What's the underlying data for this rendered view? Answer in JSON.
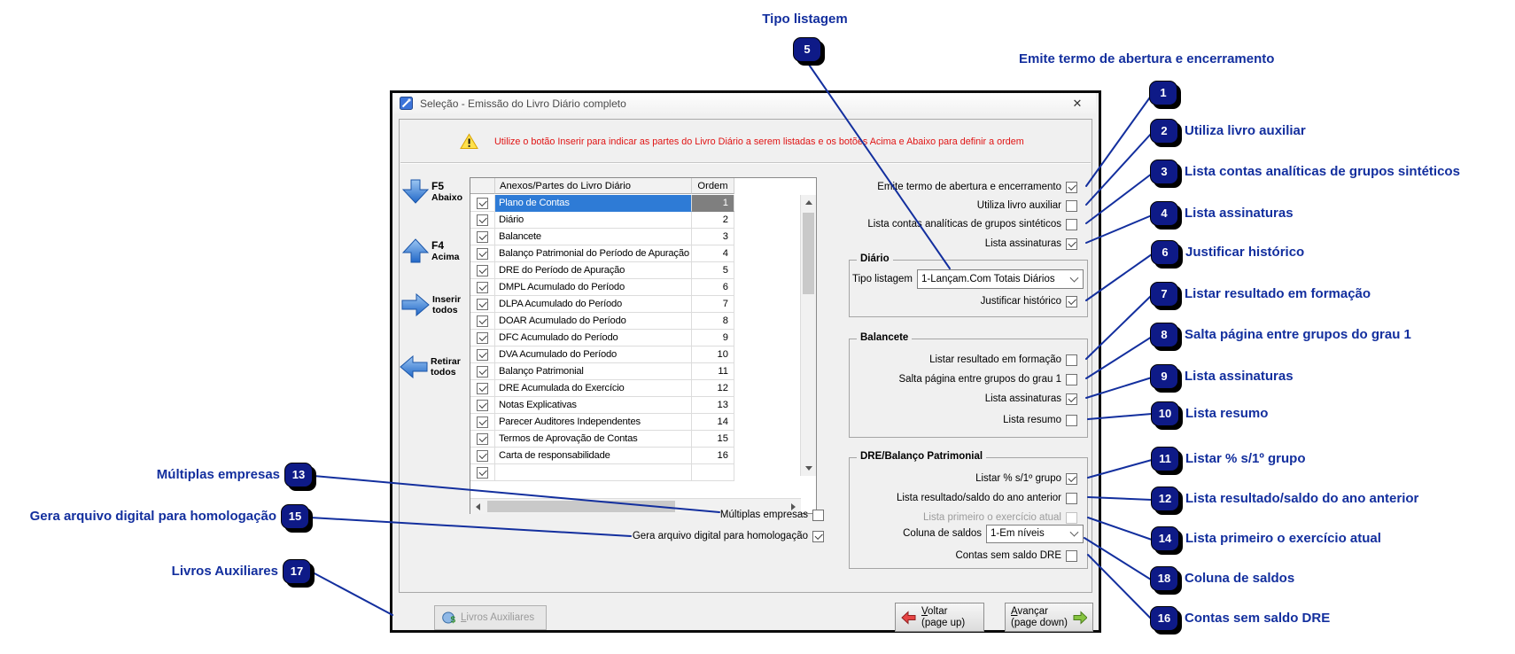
{
  "colors": {
    "annotation_blue": "#132f9e",
    "badge_navy": "#0e1a87",
    "warning_red": "#e01414",
    "selection_blue": "#2e7bd6",
    "selection_gray": "#7f7f7f",
    "arrow_blue": "#2268c8",
    "back_red": "#e64444",
    "forward_green": "#86c440"
  },
  "annotations": {
    "top": {
      "n": "5",
      "label": "Tipo listagem"
    },
    "right": [
      {
        "n": "1",
        "label": "Emite termo de abertura e encerramento"
      },
      {
        "n": "2",
        "label": "Utiliza livro auxiliar"
      },
      {
        "n": "3",
        "label": "Lista contas analíticas de grupos sintéticos"
      },
      {
        "n": "4",
        "label": "Lista assinaturas"
      },
      {
        "n": "6",
        "label": "Justificar histórico"
      },
      {
        "n": "7",
        "label": "Listar resultado em formação"
      },
      {
        "n": "8",
        "label": "Salta página entre grupos do grau 1"
      },
      {
        "n": "9",
        "label": "Lista assinaturas"
      },
      {
        "n": "10",
        "label": "Lista resumo"
      },
      {
        "n": "11",
        "label": "Listar % s/1º grupo"
      },
      {
        "n": "12",
        "label": "Lista resultado/saldo do ano anterior"
      },
      {
        "n": "14",
        "label": "Lista primeiro o exercício atual"
      },
      {
        "n": "18",
        "label": "Coluna de saldos"
      },
      {
        "n": "16",
        "label": "Contas sem saldo DRE"
      }
    ],
    "left": [
      {
        "n": "13",
        "label": "Múltiplas empresas"
      },
      {
        "n": "15",
        "label": "Gera arquivo digital para homologação"
      },
      {
        "n": "17",
        "label": "Livros Auxiliares"
      }
    ]
  },
  "dialog": {
    "title": "Seleção - Emissão do Livro Diário completo",
    "close_glyph": "✕",
    "warning": "Utilize o botão Inserir para indicar as partes do Livro Diário a serem listadas e os botões Acima e Abaixo para definir a ordem",
    "move_buttons": {
      "down": {
        "key": "F5",
        "label": "Abaixo"
      },
      "up": {
        "key": "F4",
        "label": "Acima"
      },
      "insert": {
        "line1": "Inserir",
        "line2": "todos"
      },
      "remove": {
        "line1": "Retirar",
        "line2": "todos"
      }
    },
    "table": {
      "headers": {
        "parts": "Anexos/Partes do Livro Diário",
        "order": "Ordem"
      },
      "rows": [
        {
          "name": "Plano de Contas",
          "ordem": "1"
        },
        {
          "name": "Diário",
          "ordem": "2"
        },
        {
          "name": "Balancete",
          "ordem": "3"
        },
        {
          "name": "Balanço Patrimonial do Período de Apuração",
          "ordem": "4"
        },
        {
          "name": "DRE do Período de Apuração",
          "ordem": "5"
        },
        {
          "name": "DMPL Acumulado do Período",
          "ordem": "6"
        },
        {
          "name": "DLPA Acumulado do Período",
          "ordem": "7"
        },
        {
          "name": "DOAR Acumulado do Período",
          "ordem": "8"
        },
        {
          "name": "DFC Acumulado do Período",
          "ordem": "9"
        },
        {
          "name": "DVA Acumulado do Período",
          "ordem": "10"
        },
        {
          "name": "Balanço Patrimonial",
          "ordem": "11"
        },
        {
          "name": "DRE Acumulada do Exercício",
          "ordem": "12"
        },
        {
          "name": "Notas Explicativas",
          "ordem": "13"
        },
        {
          "name": "Parecer Auditores Independentes",
          "ordem": "14"
        },
        {
          "name": "Termos de Aprovação de Contas",
          "ordem": "15"
        },
        {
          "name": "Carta de responsabilidade",
          "ordem": "16"
        }
      ]
    },
    "options": {
      "emite_termo": "Emite termo de abertura e encerramento",
      "utiliza_livro": "Utiliza livro auxiliar",
      "lista_analiticas": "Lista contas analíticas de grupos sintéticos",
      "lista_assinaturas": "Lista assinaturas"
    },
    "diario_group": {
      "title": "Diário",
      "tipo_listagem_label": "Tipo listagem",
      "tipo_listagem_value": "1-Lançam.Com Totais Diários",
      "justificar": "Justificar histórico"
    },
    "balancete_group": {
      "title": "Balancete",
      "listar_resultado": "Listar resultado em formação",
      "salta_pagina": "Salta página entre grupos do grau 1",
      "lista_assinaturas": "Lista assinaturas",
      "lista_resumo": "Lista resumo"
    },
    "dre_group": {
      "title": "DRE/Balanço Patrimonial",
      "listar_pct": "Listar % s/1º grupo",
      "lista_resultado_saldo": "Lista resultado/saldo do ano anterior",
      "lista_primeiro": "Lista primeiro o exercício atual",
      "coluna_saldos_label": "Coluna de saldos",
      "coluna_saldos_value": "1-Em níveis",
      "contas_sem_saldo": "Contas sem saldo DRE"
    },
    "extra": {
      "multiplas": "Múltiplas empresas",
      "gera_arquivo": "Gera arquivo digital para homologação"
    },
    "footer": {
      "livros": {
        "u": "L",
        "rest": "ivros Auxiliares"
      },
      "voltar": {
        "u": "V",
        "rest": "oltar",
        "sub": "(page up)"
      },
      "avancar": {
        "u": "A",
        "rest": "vançar",
        "sub": "(page down)"
      }
    }
  }
}
